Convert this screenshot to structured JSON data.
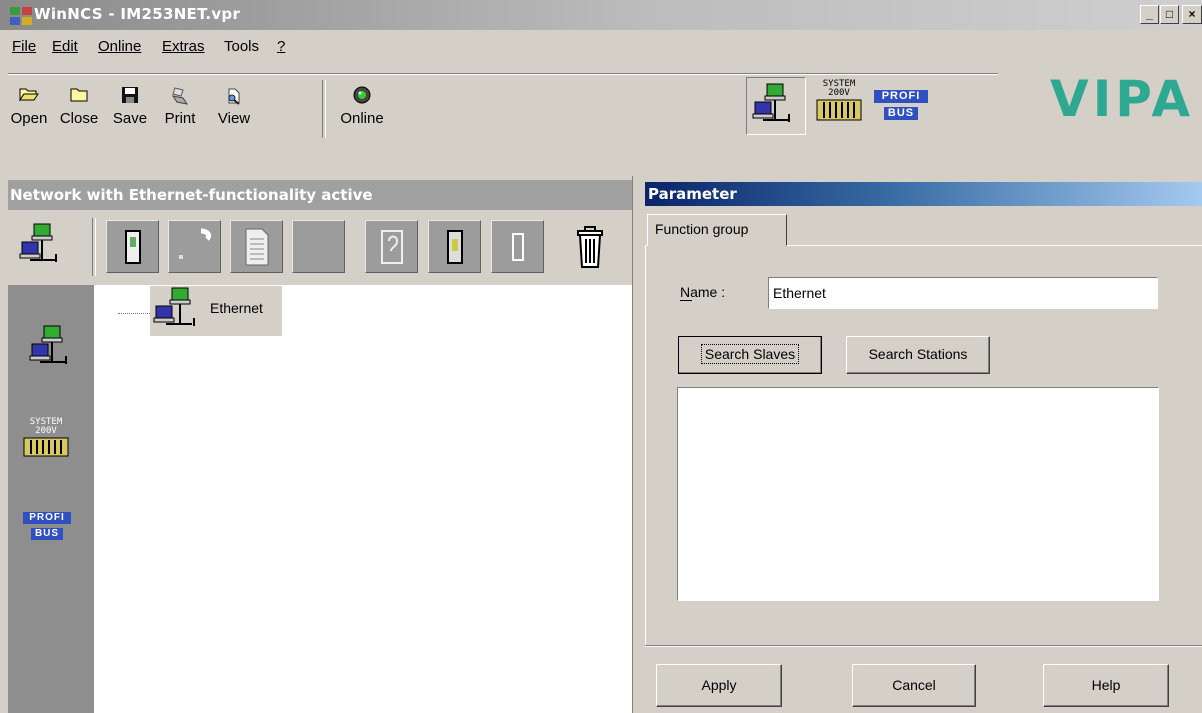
{
  "window": {
    "title": "WinNCS - IM253NET.vpr",
    "minimize_label": "_",
    "maximize_label": "□",
    "close_label": "×"
  },
  "menu": {
    "items": [
      {
        "label": "File"
      },
      {
        "label": "Edit"
      },
      {
        "label": "Online"
      },
      {
        "label": "Extras"
      },
      {
        "label": "Tools"
      },
      {
        "label": "?"
      }
    ]
  },
  "toolbar": {
    "buttons": [
      {
        "label": "Open",
        "icon": "folder-open-icon"
      },
      {
        "label": "Close",
        "icon": "folder-icon"
      },
      {
        "label": "Save",
        "icon": "floppy-icon"
      },
      {
        "label": "Print",
        "icon": "printer-icon"
      },
      {
        "label": "View",
        "icon": "view-icon"
      },
      {
        "label": "Online",
        "icon": "online-icon"
      }
    ],
    "mode_icons": [
      {
        "name": "ethernet-network-icon"
      },
      {
        "name": "system-200v-icon",
        "text_line1": "SYSTEM",
        "text_line2": "200V"
      },
      {
        "name": "profibus-icon",
        "text_line1": "PROFI",
        "text_line2": "BUS"
      }
    ],
    "logo": "VIPA"
  },
  "left_panel": {
    "header": "Network with Ethernet-functionality active",
    "tool_icons": [
      "ethernet-network-icon",
      "cpu-module-icon",
      "connection-icon",
      "document-icon",
      "blank-icon",
      "io-module-icon",
      "slave-module-icon",
      "slot-icon",
      "trash-icon"
    ],
    "side_icons": [
      {
        "name": "ethernet-network-icon"
      },
      {
        "name": "system-200v-icon",
        "text_line1": "SYSTEM",
        "text_line2": "200V"
      },
      {
        "name": "profibus-icon",
        "text_line1": "PROFI",
        "text_line2": "BUS"
      }
    ],
    "tree": {
      "root_label": "Ethernet"
    }
  },
  "right_panel": {
    "header": "Parameter",
    "tab_label": "Function group",
    "name_label": "Name :",
    "name_value": "Ethernet",
    "search_slaves_label": "Search Slaves",
    "search_stations_label": "Search Stations",
    "apply_label": "Apply",
    "cancel_label": "Cancel",
    "help_label": "Help"
  },
  "colors": {
    "logo": "#2fa892",
    "parameter_header_start": "#0a246a",
    "left_header": "#a0a0a0",
    "side_panel": "#8e8e8e"
  }
}
